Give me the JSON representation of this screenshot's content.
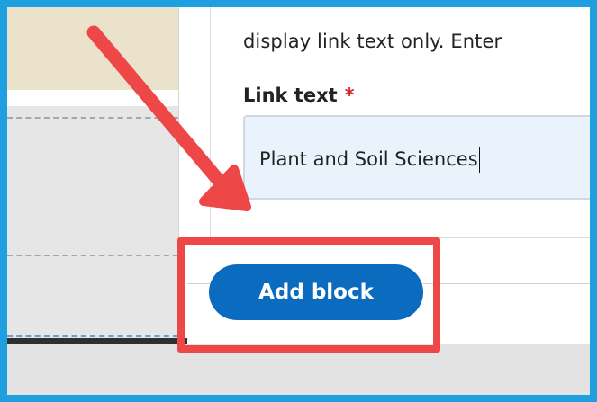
{
  "form": {
    "description": "display link text only. Enter",
    "link_text_label": "Link text",
    "required_marker": "*",
    "link_text_value": "Plant and Soil Sciences"
  },
  "actions": {
    "add_block_label": "Add block"
  },
  "annotation": {
    "accent_color": "#ee4747",
    "frame_color": "#1e9fdf",
    "button_color": "#0a6bbf"
  }
}
